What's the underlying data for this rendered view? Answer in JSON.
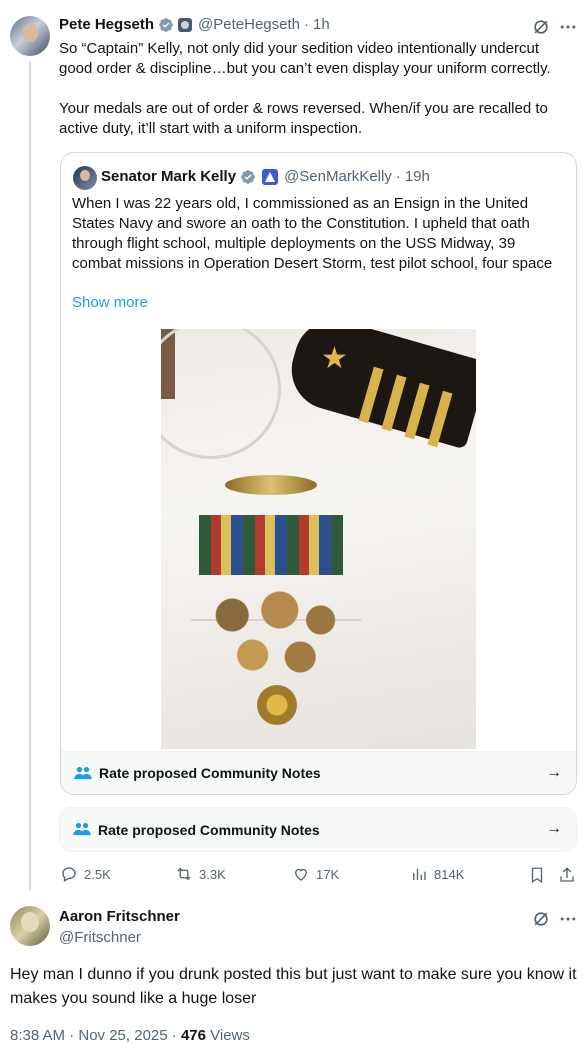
{
  "main_post": {
    "display_name": "Pete Hegseth",
    "handle": "@PeteHegseth",
    "time": "1h",
    "text": "So “Captain” Kelly, not only did your sedition video intentionally undercut good order & discipline…but you can’t even display your uniform correctly.\n\nYour medals are out of order & rows reversed. When/if you are recalled to active duty, it’ll start with a uniform inspection.",
    "avatar_icon": "pete-hegseth-avatar"
  },
  "quoted_post": {
    "display_name": "Senator Mark Kelly",
    "handle": "@SenMarkKelly",
    "time": "19h",
    "text": "When I was 22 years old, I commissioned as an Ensign in the United States Navy and swore an oath to the Constitution. I upheld that oath through flight school, multiple deployments on the USS Midway, 39 combat missions in Operation Desert Storm, test pilot school, four space",
    "show_more": "Show more",
    "image_icon": "navy-uniform-medals-photo",
    "notes_label": "Rate proposed Community Notes"
  },
  "community_notes": {
    "label": "Rate proposed Community Notes"
  },
  "actions": {
    "replies": "2.5K",
    "reposts": "3.3K",
    "likes": "17K",
    "views": "814K"
  },
  "reply": {
    "display_name": "Aaron Fritschner",
    "handle": "@Fritschner",
    "text": "Hey man I dunno if you drunk posted this but just want to make sure you know it makes you sound like a huge loser",
    "timestamp": "8:38 AM · Nov 25, 2025 · ",
    "view_count": "476",
    "views_label": " Views"
  },
  "colors": {
    "link": "#1d9bf0",
    "muted": "#536471",
    "verified": "#829aab"
  }
}
